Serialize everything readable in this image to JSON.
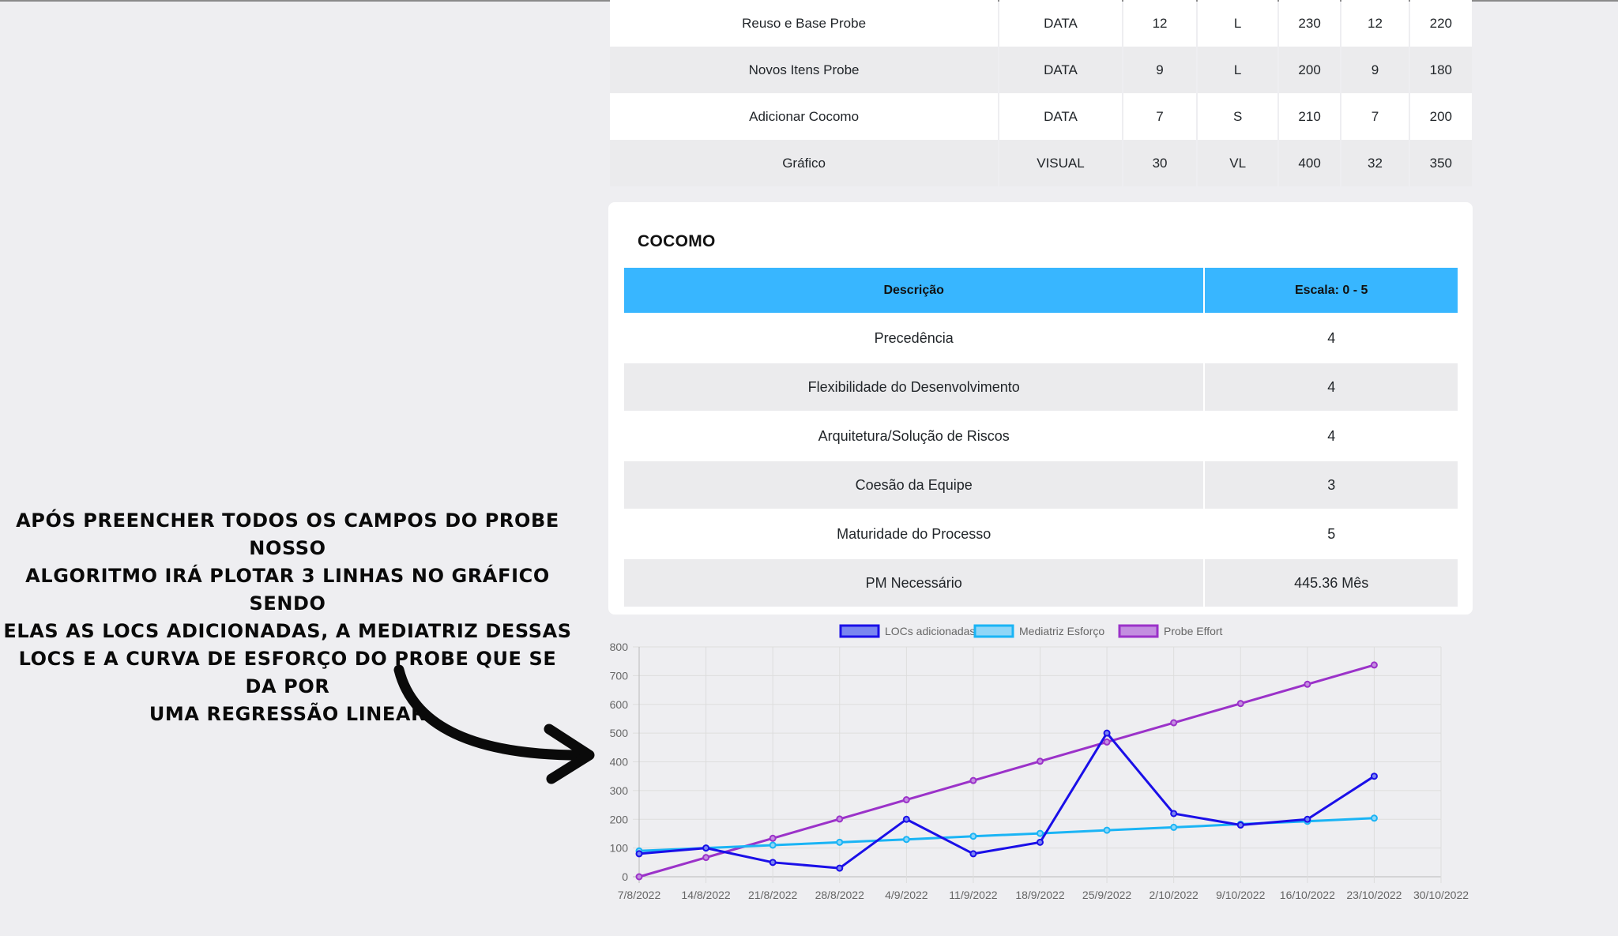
{
  "probe_items": [
    {
      "name": "Reuso e Base Probe",
      "type": "DATA",
      "a": "12",
      "size": "L",
      "b": "230",
      "c": "12",
      "d": "220"
    },
    {
      "name": "Novos Itens Probe",
      "type": "DATA",
      "a": "9",
      "size": "L",
      "b": "200",
      "c": "9",
      "d": "180"
    },
    {
      "name": "Adicionar Cocomo",
      "type": "DATA",
      "a": "7",
      "size": "S",
      "b": "210",
      "c": "7",
      "d": "200"
    },
    {
      "name": "Gráfico",
      "type": "VISUAL",
      "a": "30",
      "size": "VL",
      "b": "400",
      "c": "32",
      "d": "350"
    }
  ],
  "cocomo": {
    "title": "COCOMO",
    "header": {
      "descricao": "Descrição",
      "escala": "Escala: 0 - 5"
    },
    "rows": [
      {
        "label": "Precedência",
        "value": "4"
      },
      {
        "label": "Flexibilidade do Desenvolvimento",
        "value": "4"
      },
      {
        "label": "Arquitetura/Solução de Riscos",
        "value": "4"
      },
      {
        "label": "Coesão da Equipe",
        "value": "3"
      },
      {
        "label": "Maturidade do Processo",
        "value": "5"
      },
      {
        "label": "PM Necessário",
        "value": "445.36 Mês"
      }
    ]
  },
  "annotation": {
    "lines": [
      "Após preencher todos os campos do probe nosso",
      "algoritmo irá plotar 3 linhas no gráfico sendo",
      "elas as LOCs adicionadas, a mediatriz dessas",
      "LOCs e a curva de esforço do probe que se da por",
      "uma regressão linear"
    ],
    "icon": "curved-arrow-right-icon"
  },
  "chart_data": {
    "type": "line",
    "x": [
      "7/8/2022",
      "14/8/2022",
      "21/8/2022",
      "28/8/2022",
      "4/9/2022",
      "11/9/2022",
      "18/9/2022",
      "25/9/2022",
      "2/10/2022",
      "9/10/2022",
      "16/10/2022",
      "23/10/2022",
      "30/10/2022"
    ],
    "ylim": [
      0,
      800
    ],
    "yticks": [
      0,
      100,
      200,
      300,
      400,
      500,
      600,
      700,
      800
    ],
    "grid": true,
    "legend_position": "top",
    "series": [
      {
        "name": "LOCs adicionadas",
        "color": "#1a0fe8",
        "fill": "#7a86f0",
        "values": [
          80,
          100,
          50,
          30,
          200,
          80,
          120,
          500,
          220,
          180,
          200,
          350
        ]
      },
      {
        "name": "Mediatriz Esforço",
        "color": "#1ab4f5",
        "fill": "#8fd6f7",
        "values": [
          90,
          100,
          110,
          120,
          130,
          141,
          151,
          162,
          172,
          183,
          193,
          204
        ]
      },
      {
        "name": "Probe Effort",
        "color": "#9b32c9",
        "fill": "#c38ee0",
        "values": [
          0,
          67,
          134,
          201,
          268,
          335,
          402,
          469,
          536,
          603,
          670,
          737
        ]
      }
    ]
  }
}
